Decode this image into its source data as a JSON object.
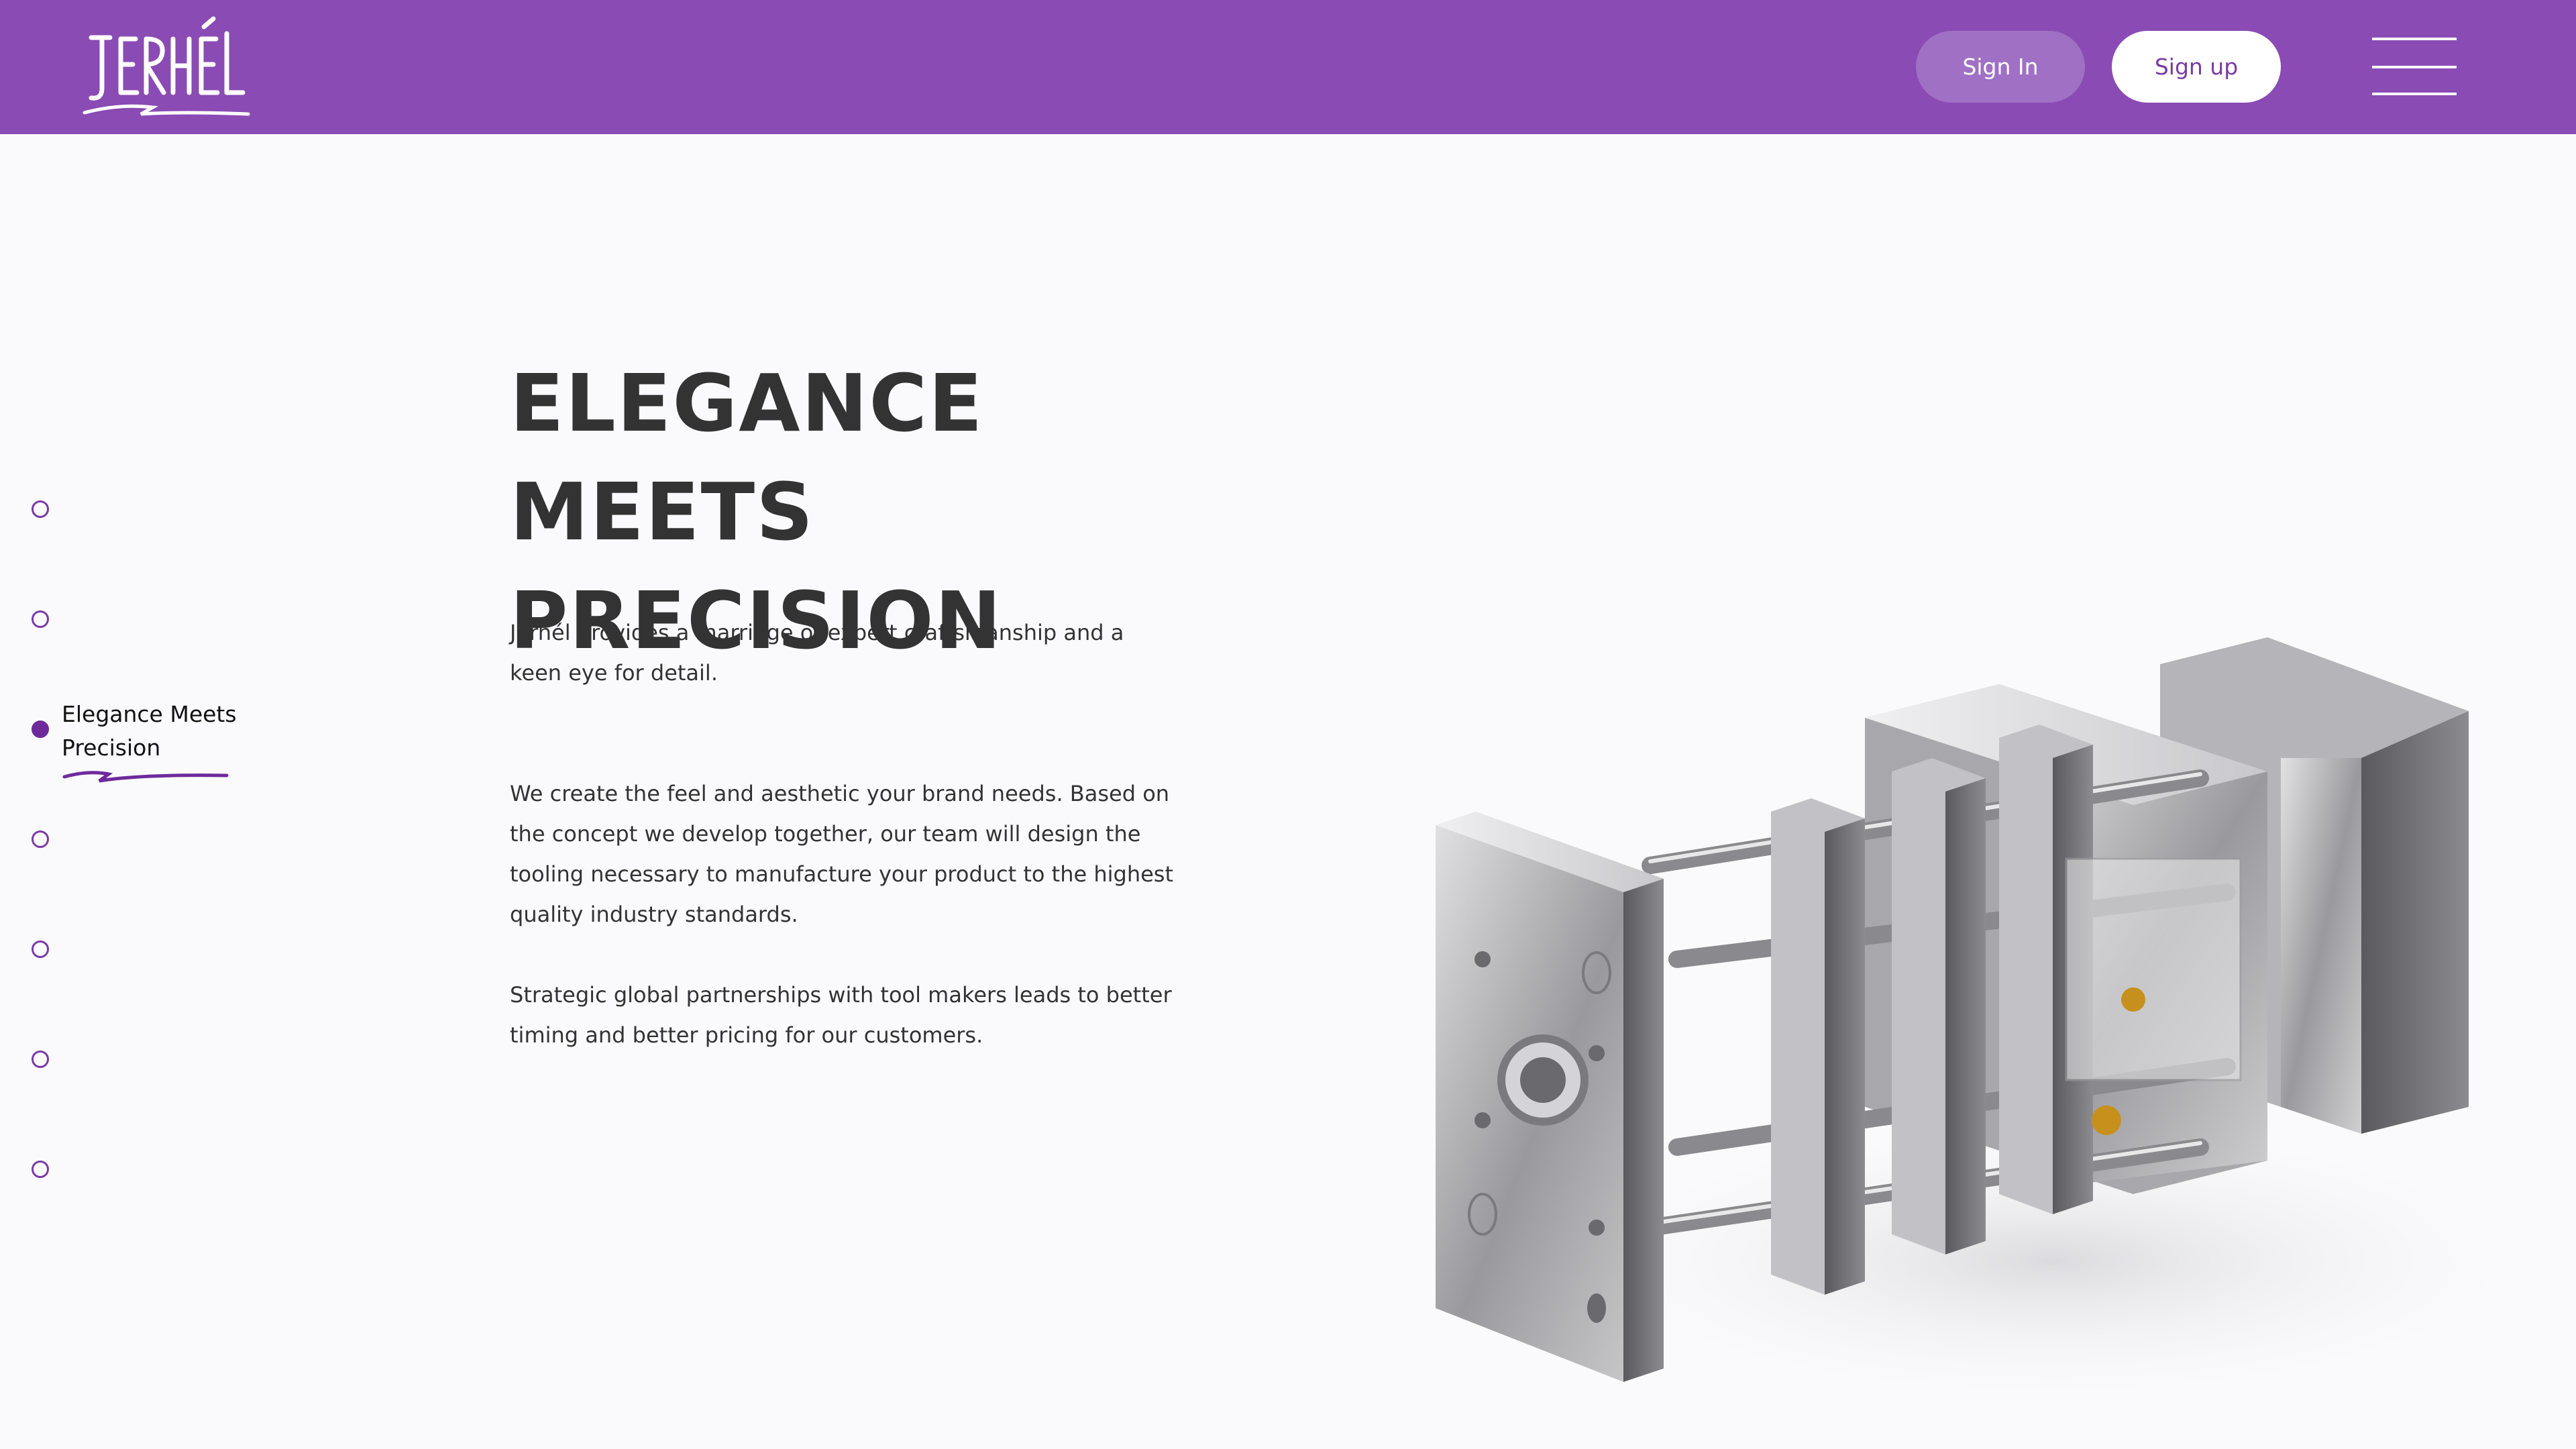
{
  "header": {
    "logo_alt": "Jerhél",
    "sign_in_label": "Sign In",
    "sign_up_label": "Sign up",
    "menu_icon": "hamburger-menu-icon"
  },
  "side_nav": {
    "active_index": 2,
    "active_label": "Elegance Meets Precision",
    "dot_count": 7
  },
  "hero": {
    "title_line1": "ELEGANCE MEETS",
    "title_line2": "PRECISION",
    "paragraph1": "Jerhél provides a marriage of expert craftsmanship and a keen eye for detail.",
    "paragraph2": "We create the feel and aesthetic your brand needs. Based on the concept we develop together, our team will design the tooling necessary to manufacture your product to the highest quality industry standards.",
    "paragraph3": "Strategic global partnerships with tool makers leads to better timing and better pricing for our customers."
  },
  "colors": {
    "brand_purple": "#8a4bb4",
    "sign_in_bg": "#a070c4",
    "accent_dark": "#6e2a9a",
    "page_bg": "#fafafc"
  }
}
